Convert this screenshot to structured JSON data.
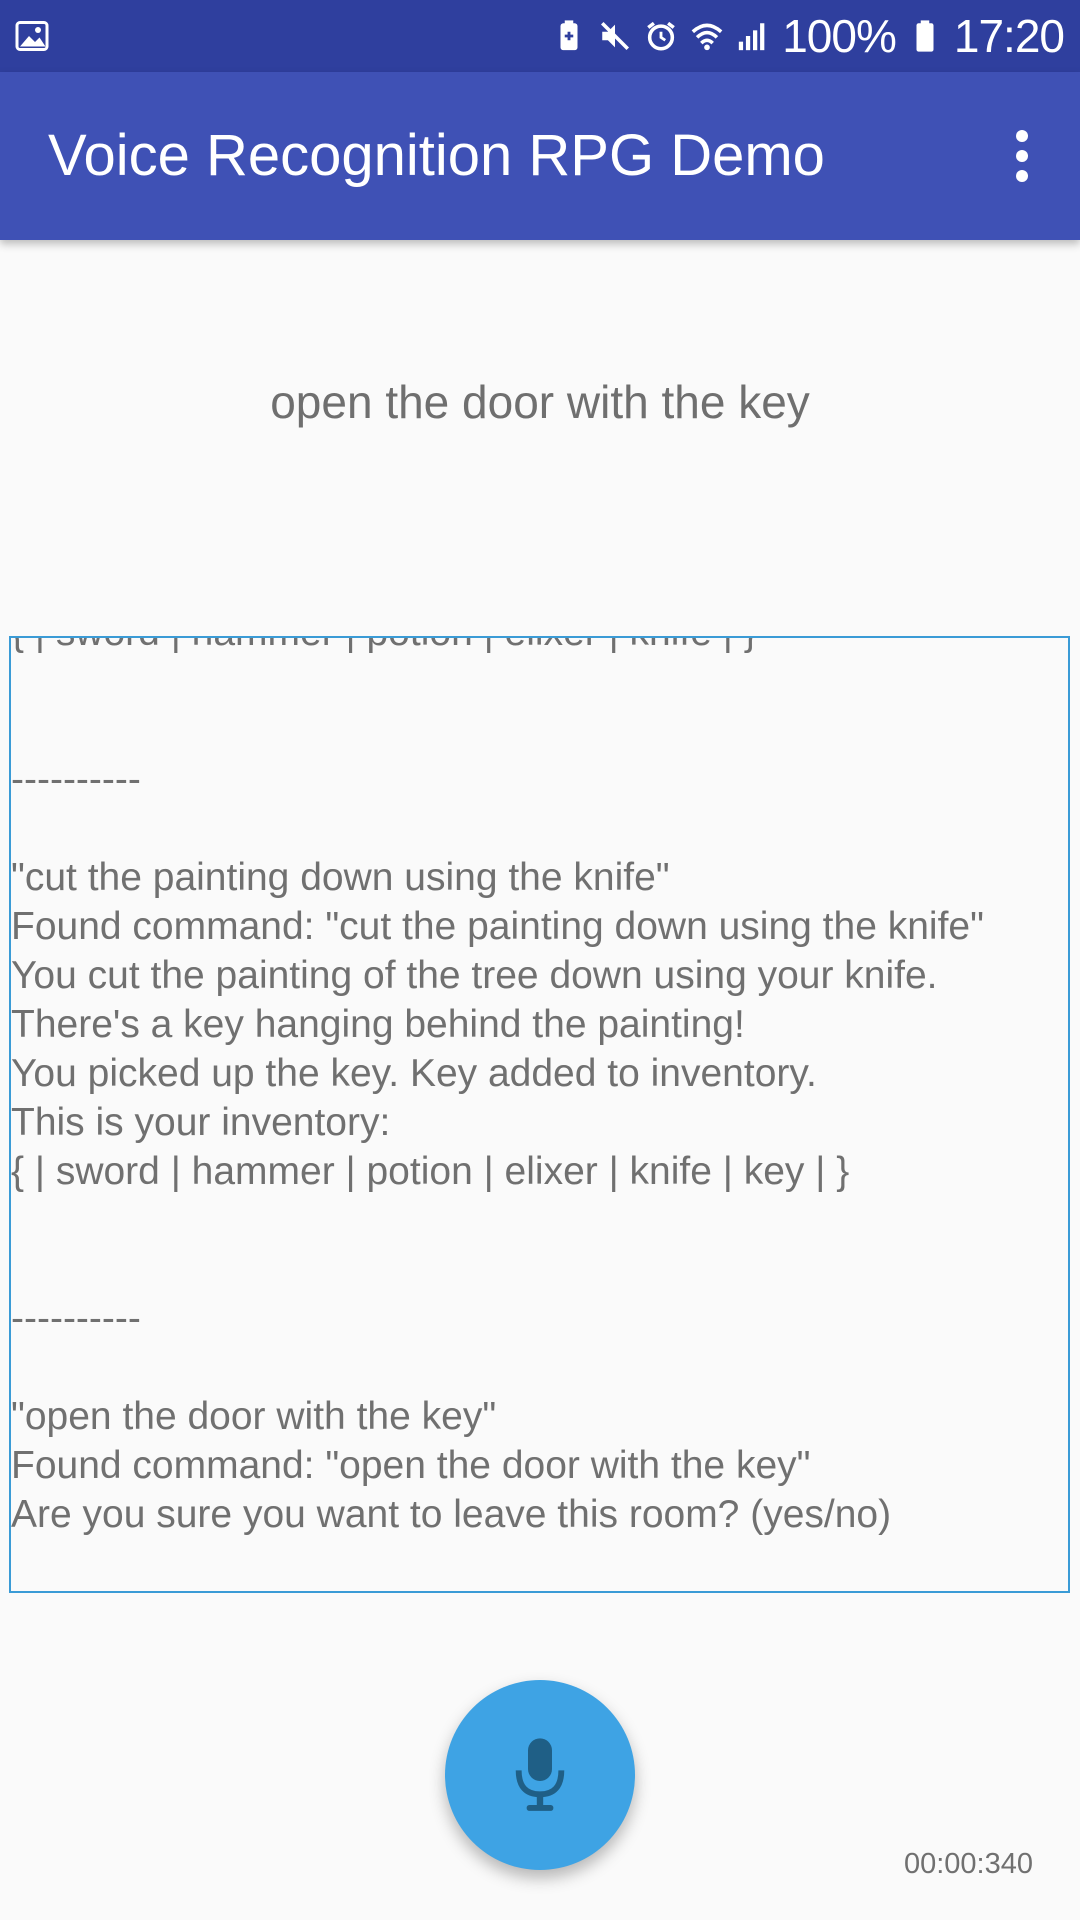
{
  "status_bar": {
    "battery_percent": "100%",
    "time": "17:20",
    "icons": [
      "image-icon",
      "battery-saver-icon",
      "mute-icon",
      "alarm-icon",
      "wifi-icon",
      "signal-icon",
      "battery-icon"
    ]
  },
  "app_bar": {
    "title": "Voice Recognition RPG Demo",
    "menu_icon": "overflow-menu-icon"
  },
  "recognized_text": "open the door with the key",
  "log": {
    "lines": [
      "{ | sword | hammer | potion | elixer | knife | }",
      "",
      "",
      "----------",
      "",
      "\"cut the painting down using the knife\"",
      "Found command: \"cut the painting down using the knife\"",
      "You cut the painting of the tree down using your knife.",
      "There's a key hanging behind the painting!",
      "You picked up the key. Key added to inventory.",
      "This is your inventory:",
      "{ | sword | hammer | potion | elixer | knife | key | }",
      "",
      "",
      "----------",
      "",
      "\"open the door with the key\"",
      "Found command: \"open the door with the key\"",
      "Are you sure you want to leave this room? (yes/no)"
    ]
  },
  "mic_button": {
    "icon": "microphone-icon"
  },
  "timer": "00:00:340",
  "colors": {
    "status_bar": "#2f3f9e",
    "app_bar": "#3f51b5",
    "accent": "#3ea3e4",
    "log_border": "#3a9bd6"
  }
}
